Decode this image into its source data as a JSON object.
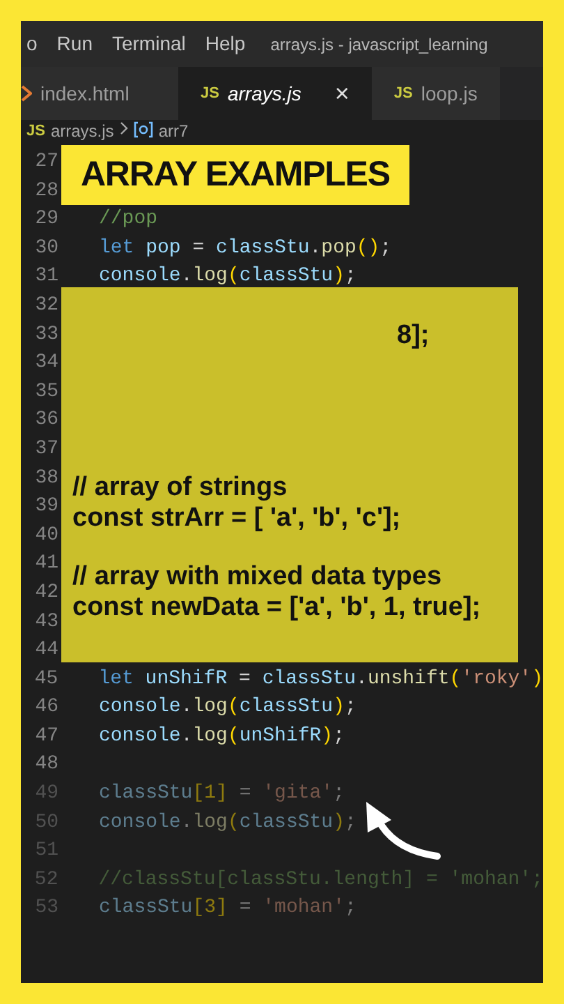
{
  "menu": {
    "items": [
      "o",
      "Run",
      "Terminal",
      "Help"
    ],
    "title": "arrays.js - javascript_learning"
  },
  "tabs": [
    {
      "kind": "html",
      "label": "index.html",
      "selected": false,
      "closable": false
    },
    {
      "kind": "js",
      "icon_text": "JS",
      "label": "arrays.js",
      "selected": true,
      "closable": true,
      "close": "×"
    },
    {
      "kind": "js",
      "icon_text": "JS",
      "label": "loop.js",
      "selected": false,
      "closable": false
    }
  ],
  "breadcrumb": {
    "icon_text": "JS",
    "file": "arrays.js",
    "symbol": "arr7"
  },
  "banner": {
    "title": "ARRAY EXAMPLES"
  },
  "code_lines": [
    {
      "number": "27"
    },
    {
      "number": "28"
    },
    {
      "number": "29",
      "tokens": [
        {
          "kind": "cm",
          "text": "//pop"
        }
      ]
    },
    {
      "number": "30",
      "tokens": [
        {
          "kind": "kw",
          "text": "let "
        },
        {
          "kind": "var",
          "text": "pop"
        },
        {
          "kind": "p",
          "text": " = "
        },
        {
          "kind": "var",
          "text": "classStu"
        },
        {
          "kind": "p",
          "text": "."
        },
        {
          "kind": "fn",
          "text": "pop"
        },
        {
          "kind": "br",
          "text": "()"
        },
        {
          "kind": "p",
          "text": ";"
        }
      ]
    },
    {
      "number": "31",
      "tokens": [
        {
          "kind": "var",
          "text": "console"
        },
        {
          "kind": "p",
          "text": "."
        },
        {
          "kind": "fn",
          "text": "log"
        },
        {
          "kind": "br",
          "text": "("
        },
        {
          "kind": "var",
          "text": "classStu"
        },
        {
          "kind": "br",
          "text": ")"
        },
        {
          "kind": "p",
          "text": ";"
        }
      ]
    },
    {
      "number": "32"
    },
    {
      "number": "33"
    },
    {
      "number": "34"
    },
    {
      "number": "35"
    },
    {
      "number": "36"
    },
    {
      "number": "37"
    },
    {
      "number": "38"
    },
    {
      "number": "39"
    },
    {
      "number": "40"
    },
    {
      "number": "41"
    },
    {
      "number": "42"
    },
    {
      "number": "43"
    },
    {
      "number": "44"
    },
    {
      "number": "45",
      "tokens": [
        {
          "kind": "kw",
          "text": "let "
        },
        {
          "kind": "var",
          "text": "unShifR"
        },
        {
          "kind": "p",
          "text": " = "
        },
        {
          "kind": "var",
          "text": "classStu"
        },
        {
          "kind": "p",
          "text": "."
        },
        {
          "kind": "fn",
          "text": "unshift"
        },
        {
          "kind": "br",
          "text": "("
        },
        {
          "kind": "str",
          "text": "'roky'"
        },
        {
          "kind": "br",
          "text": ")"
        }
      ]
    },
    {
      "number": "46",
      "tokens": [
        {
          "kind": "var",
          "text": "console"
        },
        {
          "kind": "p",
          "text": "."
        },
        {
          "kind": "fn",
          "text": "log"
        },
        {
          "kind": "br",
          "text": "("
        },
        {
          "kind": "var",
          "text": "classStu"
        },
        {
          "kind": "br",
          "text": ")"
        },
        {
          "kind": "p",
          "text": ";"
        }
      ]
    },
    {
      "number": "47",
      "tokens": [
        {
          "kind": "var",
          "text": "console"
        },
        {
          "kind": "p",
          "text": "."
        },
        {
          "kind": "fn",
          "text": "log"
        },
        {
          "kind": "br",
          "text": "("
        },
        {
          "kind": "var",
          "text": "unShifR"
        },
        {
          "kind": "br",
          "text": ")"
        },
        {
          "kind": "p",
          "text": ";"
        }
      ]
    },
    {
      "number": "48"
    },
    {
      "number": "49",
      "dim": true,
      "tokens": [
        {
          "kind": "var",
          "text": "classStu"
        },
        {
          "kind": "br",
          "text": "[1]"
        },
        {
          "kind": "p",
          "text": " = "
        },
        {
          "kind": "str",
          "text": "'gita'"
        },
        {
          "kind": "p",
          "text": ";"
        }
      ]
    },
    {
      "number": "50",
      "dim": true,
      "tokens": [
        {
          "kind": "var",
          "text": "console"
        },
        {
          "kind": "p",
          "text": "."
        },
        {
          "kind": "fn",
          "text": "log"
        },
        {
          "kind": "br",
          "text": "("
        },
        {
          "kind": "var",
          "text": "classStu"
        },
        {
          "kind": "br",
          "text": ")"
        },
        {
          "kind": "p",
          "text": ";"
        }
      ]
    },
    {
      "number": "51",
      "dim": true
    },
    {
      "number": "52",
      "dim": true,
      "tokens": [
        {
          "kind": "cm",
          "text": "//classStu[classStu.length] = 'mohan';"
        }
      ]
    },
    {
      "number": "53",
      "dim": true,
      "tokens": [
        {
          "kind": "var",
          "text": "classStu"
        },
        {
          "kind": "br",
          "text": "[3]"
        },
        {
          "kind": "p",
          "text": " = "
        },
        {
          "kind": "str",
          "text": "'mohan'"
        },
        {
          "kind": "p",
          "text": ";"
        }
      ]
    }
  ],
  "overlay": {
    "fragment": "8];",
    "blocks": [
      {
        "comment": "// array of strings",
        "code": "const strArr = [ 'a', 'b', 'c'];"
      },
      {
        "comment": "// array with mixed data types",
        "code": "const newData = ['a', 'b', 1, true];"
      }
    ]
  }
}
